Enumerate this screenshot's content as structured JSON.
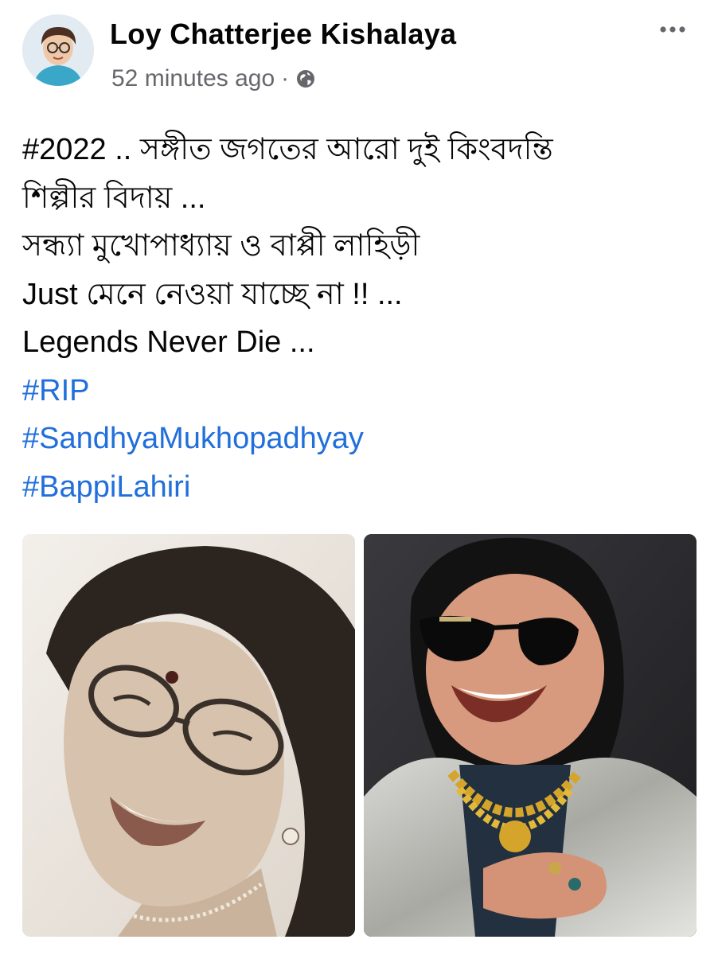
{
  "post": {
    "author": "Loy Chatterjee Kishalaya",
    "timestamp": "52 minutes ago",
    "separator": "·",
    "privacy_icon": "globe-icon",
    "menu_icon": "more-horizontal-icon",
    "lines": [
      "#2022 .. সঙ্গীত জগতের আরো দুই কিংবদন্তি",
      "শিল্পীর বিদায় ...",
      "সন্ধ্যা মুখোপাধ্যায় ও বাপ্পী লাহিড়ী",
      "Just মেনে নেওয়া যাচ্ছে না !! ...",
      "Legends Never Die ..."
    ],
    "hashtags": [
      "#RIP",
      "#SandhyaMukhopadhyay",
      "#BappiLahiri"
    ],
    "photos": [
      {
        "subject": "sepia portrait photo of a smiling woman wearing glasses"
      },
      {
        "subject": "photo of a smiling man wearing dark sunglasses, gold chains and a silver jacket"
      }
    ]
  },
  "colors": {
    "text": "#050505",
    "meta": "#65676b",
    "hashtag": "#216fdb"
  }
}
